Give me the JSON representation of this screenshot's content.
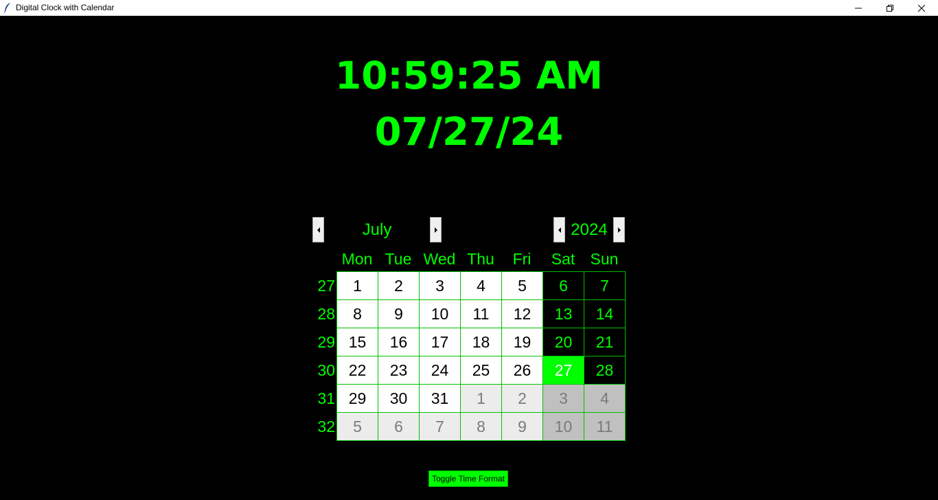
{
  "window": {
    "title": "Digital Clock with Calendar"
  },
  "clock": {
    "time": "10:59:25 AM",
    "date": "07/27/24",
    "color": "#00ff00"
  },
  "calendar": {
    "month": "July",
    "year": "2024",
    "days_of_week": [
      "Mon",
      "Tue",
      "Wed",
      "Thu",
      "Fri",
      "Sat",
      "Sun"
    ],
    "week_numbers": [
      "27",
      "28",
      "29",
      "30",
      "31",
      "32"
    ],
    "weeks": [
      [
        "1",
        "2",
        "3",
        "4",
        "5",
        "6",
        "7"
      ],
      [
        "8",
        "9",
        "10",
        "11",
        "12",
        "13",
        "14"
      ],
      [
        "15",
        "16",
        "17",
        "18",
        "19",
        "20",
        "21"
      ],
      [
        "22",
        "23",
        "24",
        "25",
        "26",
        "27",
        "28"
      ],
      [
        "29",
        "30",
        "31",
        "1",
        "2",
        "3",
        "4"
      ],
      [
        "5",
        "6",
        "7",
        "8",
        "9",
        "10",
        "11"
      ]
    ],
    "selected_day": "27",
    "icons": {
      "prev": "triangle-left-icon",
      "next": "triangle-right-icon"
    }
  },
  "toggle_button": {
    "label": "Toggle Time Format"
  }
}
